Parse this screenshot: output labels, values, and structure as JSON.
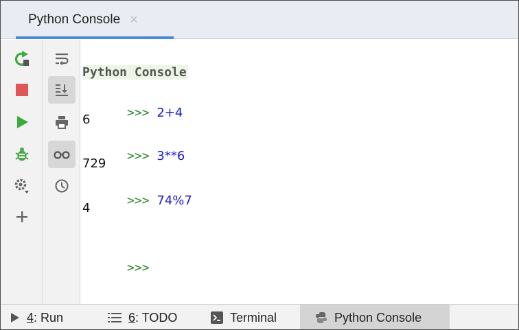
{
  "tab": {
    "title": "Python Console",
    "close_glyph": "×"
  },
  "console": {
    "banner": "Python Console",
    "prompt": ">>>",
    "entries": [
      {
        "input": "2+4",
        "output": "6"
      },
      {
        "input": "3**6",
        "output": "729"
      },
      {
        "input": "74%7",
        "output": "4"
      }
    ]
  },
  "toolbar_left": [
    "rerun-icon",
    "stop-icon",
    "run-icon",
    "debug-icon",
    "settings-icon",
    "add-icon"
  ],
  "toolbar_right": [
    "soft-wrap-icon",
    "scroll-to-end-icon",
    "print-icon",
    "show-variables-icon",
    "history-icon"
  ],
  "statusbar": {
    "run": {
      "num": "4",
      "label": ": Run"
    },
    "todo": {
      "num": "6",
      "label": ": TODO"
    },
    "terminal": "Terminal",
    "python_console": "Python Console"
  },
  "colors": {
    "accent": "#4a8bd6",
    "prompt": "#2e8b2e",
    "input": "#1b1bd0",
    "stop": "#e05555",
    "run": "#3daa3d",
    "banner_bg": "#edf6e6"
  }
}
